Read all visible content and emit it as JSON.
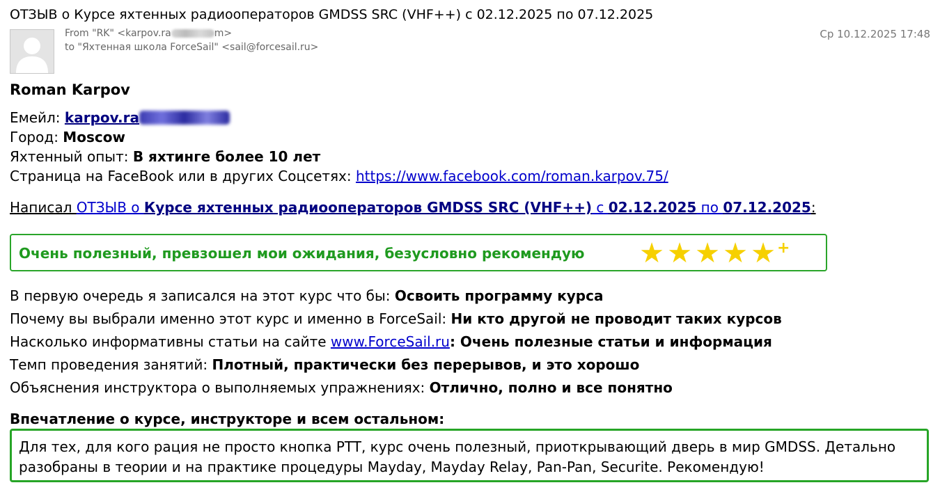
{
  "email": {
    "subject": "ОТЗЫВ о Курсе яхтенных радиооператоров GMDSS SRC (VHF++) с 02.12.2025 по 07.12.2025",
    "from_prefix": "From \"RK\" <karpov.ra",
    "from_suffix": "m>",
    "to": "to \"Яхтенная школа ForceSail\" <sail@forcesail.ru>",
    "date": "Ср 10.12.2025 17:48"
  },
  "body": {
    "name": "Roman Karpov",
    "email_label": "Емейл: ",
    "email_value": "karpov.ra",
    "city_label": "Город: ",
    "city_value": "Moscow",
    "experience_label": "Яхтенный опыт: ",
    "experience_value": "В яхтинге более 10 лет",
    "social_label": "Страница на FaceBook или в других Соцсетях: ",
    "social_link": "https://www.facebook.com/roman.karpov.75/",
    "wrote_1": "Написал ",
    "wrote_review_link": "ОТЗЫВ",
    "wrote_2": " о ",
    "wrote_course_link": "Курсе яхтенных радиооператоров GMDSS SRC (VHF++)",
    "wrote_3": " с ",
    "wrote_date1": "02.12.2025",
    "wrote_4": " по ",
    "wrote_date2": "07.12.2025",
    "wrote_5": ":",
    "verdict": "Очень полезный, превзошел мои ожидания, безусловно рекомендую",
    "rating": 5,
    "rating_plus": "+",
    "q1_label": "В первую очередь я записался на этот курс что бы: ",
    "q1_value": "Освоить программу курса",
    "q2_label": "Почему вы выбрали именно этот курс и именно в ForceSail: ",
    "q2_value": "Ни кто другой не проводит таких курсов",
    "q3_label": "Насколько информативны статьи на сайте ",
    "q3_link": "www.ForceSail.ru",
    "q3_sep": ": ",
    "q3_value": "Очень полезные статьи и информация",
    "q4_label": "Темп проведения занятий: ",
    "q4_value": "Плотный, практически без перерывов, и это хорошо",
    "q5_label": "Объяснения инструктора о выполняемых упражнениях: ",
    "q5_value": "Отлично, полно и все понятно",
    "impression_title": "Впечатление о курсе, инструкторе и всем остальном:",
    "impression_text": "Для тех, для кого рация не просто кнопка PTT, курс очень полезный, приоткрывающий дверь в мир GMDSS. Детально разобраны в теории и на практике процедуры Mayday, Mayday Relay, Pan-Pan, Securite. Рекомендую!"
  },
  "colors": {
    "green": "#2aa52a",
    "star": "#f6d000",
    "link": "#0000cc"
  }
}
